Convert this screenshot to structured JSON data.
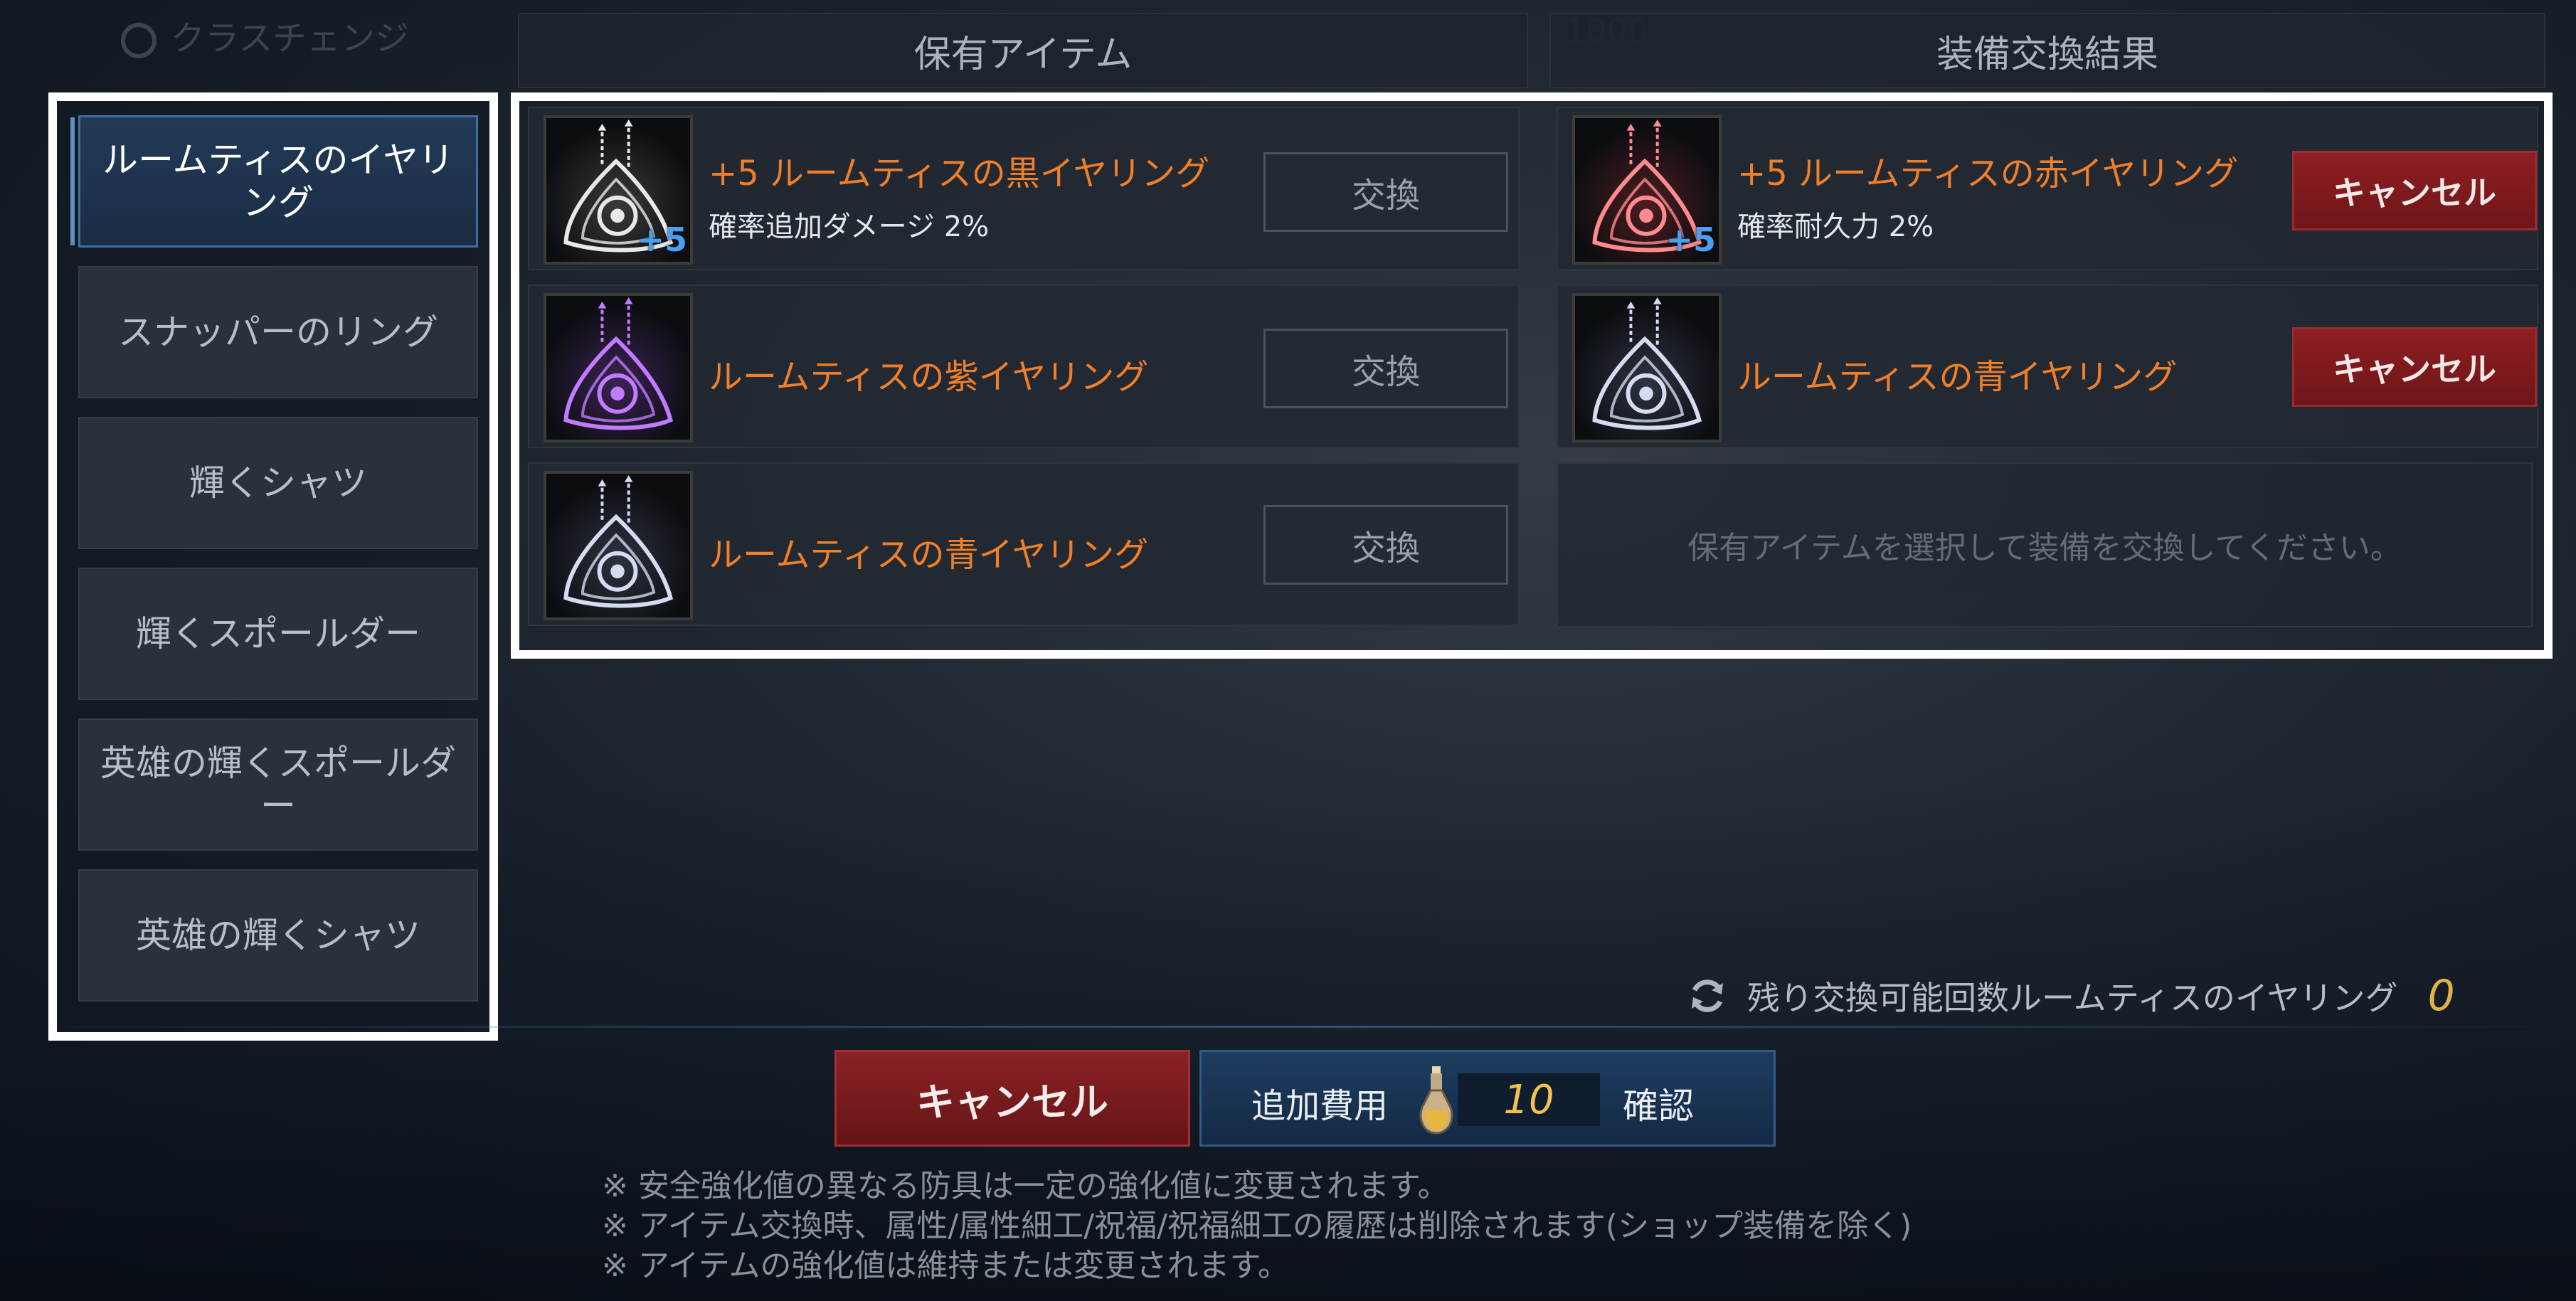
{
  "background_top": {
    "left_text": "クラスチェンジ",
    "right_text": "1000"
  },
  "headers": {
    "owned": "保有アイテム",
    "result": "装備交換結果"
  },
  "sidebar": {
    "items": [
      {
        "label": "ルームティスのイヤリング",
        "active": true
      },
      {
        "label": "スナッパーのリング"
      },
      {
        "label": "輝くシャツ"
      },
      {
        "label": "輝くスポールダー"
      },
      {
        "label": "英雄の輝くスポールダー"
      },
      {
        "label": "英雄の輝くシャツ"
      }
    ]
  },
  "owned_items": [
    {
      "name": "+5 ルームティスの黒イヤリング",
      "sub": "確率追加ダメージ 2%",
      "plus": "+5",
      "button": "交換",
      "icon": "earring-white-icon"
    },
    {
      "name": "ルームティスの紫イヤリング",
      "button": "交換",
      "icon": "earring-purple-icon"
    },
    {
      "name": "ルームティスの青イヤリング",
      "button": "交換",
      "icon": "earring-silver-icon"
    }
  ],
  "result_items": [
    {
      "name": "+5 ルームティスの赤イヤリング",
      "sub": "確率耐久力 2%",
      "plus": "+5",
      "button": "キャンセル",
      "icon": "earring-red-icon"
    },
    {
      "name": "ルームティスの青イヤリング",
      "button": "キャンセル",
      "icon": "earring-silver-icon"
    }
  ],
  "empty_hint": "保有アイテムを選択して装備を交換してください。",
  "remaining": {
    "label": "残り交換可能回数ルームティスのイヤリング",
    "count": "0"
  },
  "footer": {
    "cancel": "キャンセル",
    "extra_cost_label": "追加費用",
    "extra_cost_value": "10",
    "confirm": "確認"
  },
  "notes": [
    "※ 安全強化値の異なる防具は一定の強化値に変更されます。",
    "※ アイテム交換時、属性/属性細工/祝福/祝福細工の履歴は削除されます(ショップ装備を除く)",
    "※ アイテムの強化値は維持または変更されます。"
  ],
  "colors": {
    "item_name": "#f07f2a",
    "plus_badge": "#4aa0f0",
    "cancel_red": "#8a2224",
    "confirm_blue": "#1e3c60",
    "gold": "#f2c24f"
  }
}
